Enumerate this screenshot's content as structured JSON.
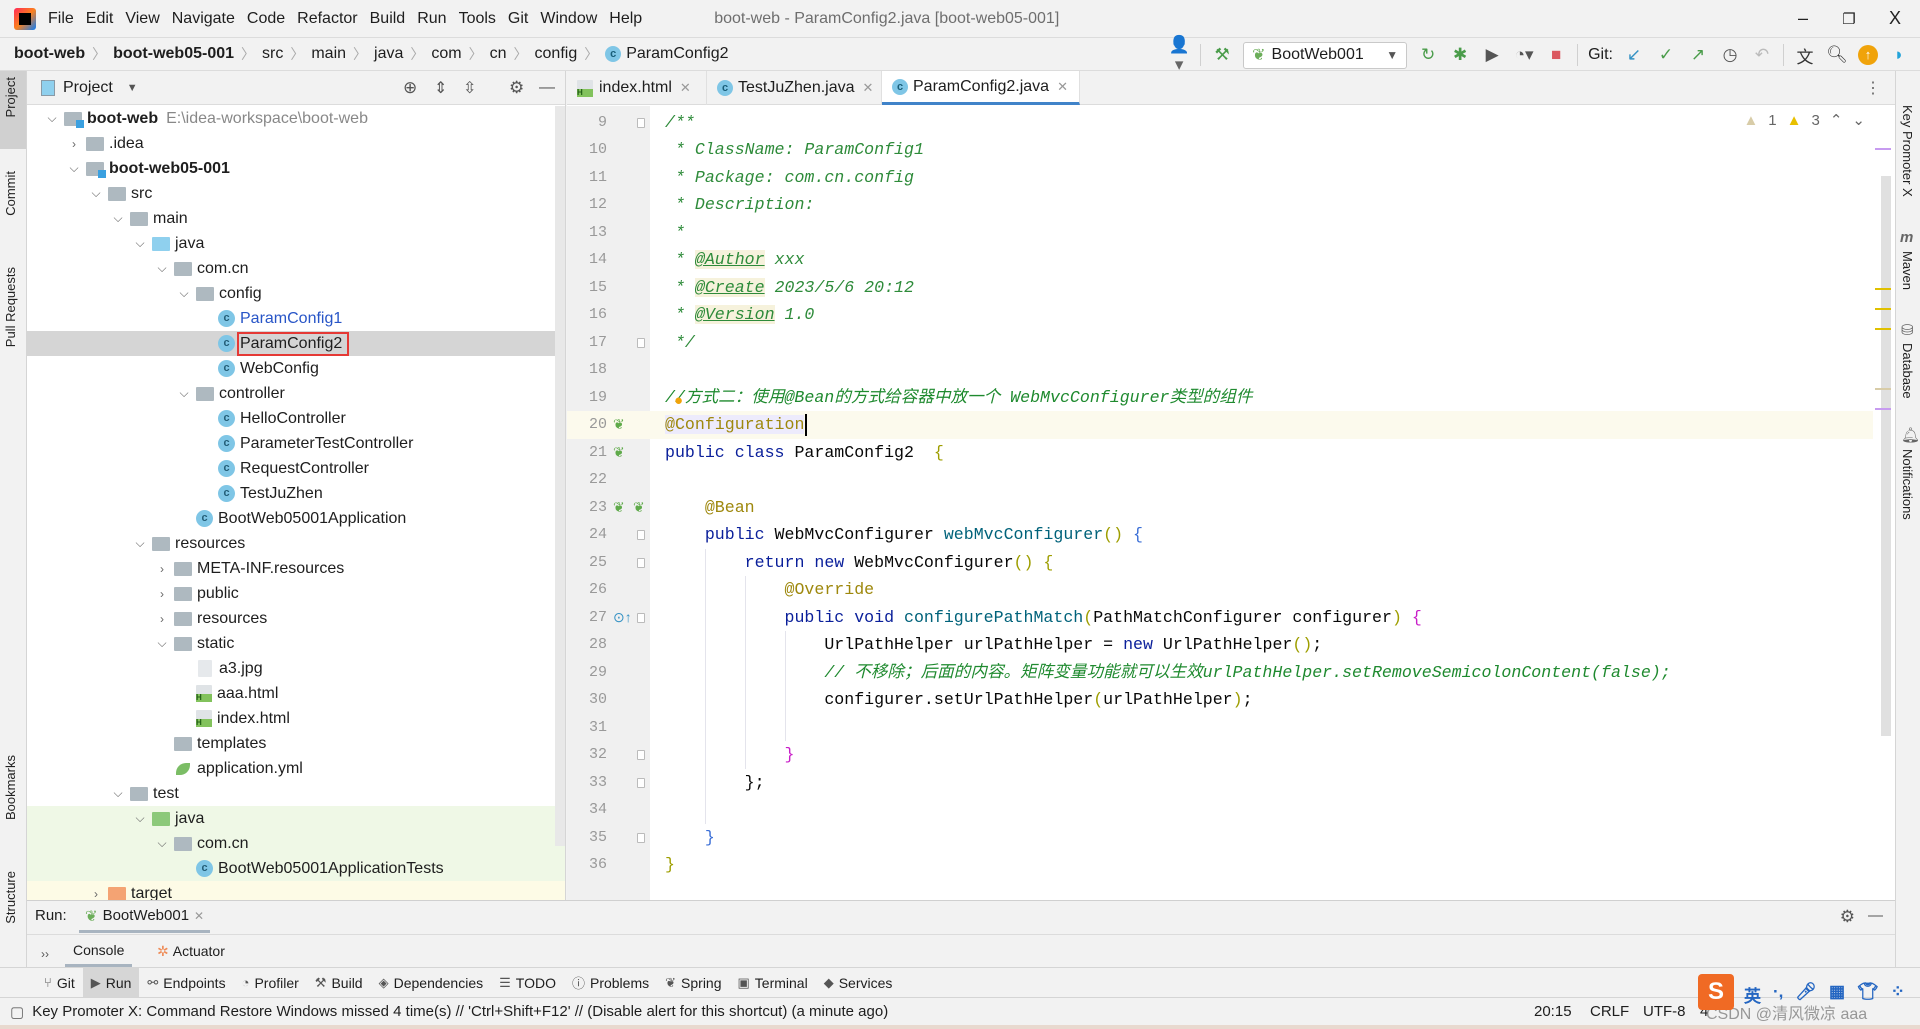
{
  "window": {
    "title": "boot-web - ParamConfig2.java [boot-web05-001]",
    "minimize": "–",
    "restore": "❐",
    "close": "X"
  },
  "menu": [
    "File",
    "Edit",
    "View",
    "Navigate",
    "Code",
    "Refactor",
    "Build",
    "Run",
    "Tools",
    "Git",
    "Window",
    "Help"
  ],
  "breadcrumb": [
    "boot-web",
    "boot-web05-001",
    "src",
    "main",
    "java",
    "com",
    "cn",
    "config",
    "ParamConfig2"
  ],
  "toolbar": {
    "run_config": "BootWeb001",
    "git_label": "Git:"
  },
  "left_stripe": [
    "Project",
    "Commit",
    "Pull Requests",
    "Bookmarks",
    "Structure"
  ],
  "right_stripe": [
    "Key Promoter X",
    "Maven",
    "Database",
    "Notifications"
  ],
  "project": {
    "title": "Project",
    "tree": [
      {
        "level": 0,
        "label": "boot-web",
        "path": "E:\\idea-workspace\\boot-web",
        "bold": true,
        "arrow": "down",
        "icon": "module"
      },
      {
        "level": 1,
        "label": ".idea",
        "arrow": "right",
        "icon": "folder"
      },
      {
        "level": 1,
        "label": "boot-web05-001",
        "bold": true,
        "arrow": "down",
        "icon": "module"
      },
      {
        "level": 2,
        "label": "src",
        "arrow": "down",
        "icon": "folder"
      },
      {
        "level": 3,
        "label": "main",
        "arrow": "down",
        "icon": "folder"
      },
      {
        "level": 4,
        "label": "java",
        "arrow": "down",
        "icon": "blue"
      },
      {
        "level": 5,
        "label": "com.cn",
        "arrow": "down",
        "icon": "folder"
      },
      {
        "level": 6,
        "label": "config",
        "arrow": "down",
        "icon": "folder"
      },
      {
        "level": 7,
        "label": "ParamConfig1",
        "icon": "cls",
        "color": "#2855c7"
      },
      {
        "level": 7,
        "label": "ParamConfig2",
        "icon": "cls",
        "selected": true
      },
      {
        "level": 7,
        "label": "WebConfig",
        "icon": "cls"
      },
      {
        "level": 6,
        "label": "controller",
        "arrow": "down",
        "icon": "folder"
      },
      {
        "level": 7,
        "label": "HelloController",
        "icon": "cls"
      },
      {
        "level": 7,
        "label": "ParameterTestController",
        "icon": "cls"
      },
      {
        "level": 7,
        "label": "RequestController",
        "icon": "cls"
      },
      {
        "level": 7,
        "label": "TestJuZhen",
        "icon": "cls"
      },
      {
        "level": 6,
        "label": "BootWeb05001Application",
        "icon": "cls"
      },
      {
        "level": 4,
        "label": "resources",
        "arrow": "down",
        "icon": "folder"
      },
      {
        "level": 5,
        "label": "META-INF.resources",
        "arrow": "right",
        "icon": "folder"
      },
      {
        "level": 5,
        "label": "public",
        "arrow": "right",
        "icon": "folder"
      },
      {
        "level": 5,
        "label": "resources",
        "arrow": "right",
        "icon": "folder"
      },
      {
        "level": 5,
        "label": "static",
        "arrow": "down",
        "icon": "folder"
      },
      {
        "level": 6,
        "label": "a3.jpg",
        "icon": "file"
      },
      {
        "level": 6,
        "label": "aaa.html",
        "icon": "html"
      },
      {
        "level": 6,
        "label": "index.html",
        "icon": "html"
      },
      {
        "level": 5,
        "label": "templates",
        "icon": "folder"
      },
      {
        "level": 5,
        "label": "application.yml",
        "icon": "yml"
      },
      {
        "level": 3,
        "label": "test",
        "arrow": "down",
        "icon": "folder"
      },
      {
        "level": 4,
        "label": "java",
        "arrow": "down",
        "icon": "green",
        "bg": "#eff8e6"
      },
      {
        "level": 5,
        "label": "com.cn",
        "arrow": "down",
        "icon": "folder",
        "bg": "#eff8e6"
      },
      {
        "level": 6,
        "label": "BootWeb05001ApplicationTests",
        "icon": "cls",
        "bg": "#eff8e6"
      },
      {
        "level": 2,
        "label": "target",
        "arrow": "right",
        "icon": "orange",
        "bg": "#fdfbe6"
      }
    ]
  },
  "tabs": [
    {
      "label": "index.html",
      "icon": "html"
    },
    {
      "label": "TestJuZhen.java",
      "icon": "cls"
    },
    {
      "label": "ParamConfig2.java",
      "icon": "cls",
      "active": true
    }
  ],
  "inspections": {
    "weak_warnings": "1",
    "warnings": "3"
  },
  "code": {
    "first_line": 8,
    "current_line": 20,
    "lines": [
      [],
      [
        [
          "/**",
          "doc"
        ]
      ],
      [
        [
          " * ClassName: ParamConfig1",
          "doc"
        ]
      ],
      [
        [
          " * Package: com.cn.config",
          "doc"
        ]
      ],
      [
        [
          " * Description:",
          "doc"
        ]
      ],
      [
        [
          " *",
          "doc"
        ]
      ],
      [
        [
          " * ",
          "doc"
        ],
        [
          "@Author",
          "doctag"
        ],
        [
          " xxx",
          "doc"
        ]
      ],
      [
        [
          " * ",
          "doc"
        ],
        [
          "@Create",
          "doctag"
        ],
        [
          " 2023/5/6 20:12",
          "doc"
        ]
      ],
      [
        [
          " * ",
          "doc"
        ],
        [
          "@Version",
          "doctag"
        ],
        [
          " 1.0",
          "doc"
        ]
      ],
      [
        [
          " */",
          "doc"
        ]
      ],
      [],
      [
        [
          "//方式二：使用@Bean的方式给容器中放一个 WebMvcConfigurer类型的组件",
          "cm"
        ]
      ],
      [
        [
          "@Configuration",
          "annhl"
        ]
      ],
      [
        [
          "public class ",
          "kw"
        ],
        [
          "ParamConfig2  ",
          "plain"
        ],
        [
          "{",
          "br1"
        ]
      ],
      [],
      [
        [
          "    @Bean",
          "ann"
        ]
      ],
      [
        [
          "    public ",
          "kw"
        ],
        [
          "WebMvcConfigurer ",
          "plain"
        ],
        [
          "webMvcConfigurer",
          "fn"
        ],
        [
          "() ",
          "br1"
        ],
        [
          "{",
          "br2"
        ]
      ],
      [
        [
          "        return new ",
          "kw"
        ],
        [
          "WebMvcConfigurer",
          "plain"
        ],
        [
          "() ",
          "br1"
        ],
        [
          "{",
          "br1"
        ]
      ],
      [
        [
          "            @Override",
          "ann"
        ]
      ],
      [
        [
          "            public void ",
          "kw"
        ],
        [
          "configurePathMatch",
          "fn"
        ],
        [
          "(",
          "br1"
        ],
        [
          "PathMatchConfigurer configurer",
          "plain"
        ],
        [
          ") ",
          "br1"
        ],
        [
          "{",
          "br3"
        ]
      ],
      [
        [
          "                UrlPathHelper urlPathHelper = ",
          "plain"
        ],
        [
          "new ",
          "kw"
        ],
        [
          "UrlPathHelper",
          "plain"
        ],
        [
          "()",
          "br1"
        ],
        [
          ";",
          "plain"
        ]
      ],
      [
        [
          "                // 不移除；后面的内容。矩阵变量功能就可以生效urlPathHelper.setRemoveSemicolonContent(false);",
          "cm"
        ]
      ],
      [
        [
          "                configurer.setUrlPathHelper",
          "plain"
        ],
        [
          "(",
          "br1"
        ],
        [
          "urlPathHelper",
          "plain"
        ],
        [
          ")",
          "br1"
        ],
        [
          ";",
          "plain"
        ]
      ],
      [],
      [
        [
          "            }",
          "br3"
        ]
      ],
      [
        [
          "        };",
          "plain"
        ]
      ],
      [],
      [
        [
          "    }",
          "br2"
        ]
      ],
      [
        [
          "}",
          "br1"
        ]
      ]
    ]
  },
  "run": {
    "label": "Run:",
    "config": "BootWeb001",
    "tabs": [
      "Console",
      "Actuator"
    ],
    "more": "››"
  },
  "bottom_tools": [
    "Git",
    "Run",
    "Endpoints",
    "Profiler",
    "Build",
    "Dependencies",
    "TODO",
    "Problems",
    "Spring",
    "Terminal",
    "Services"
  ],
  "status": {
    "message": "Key Promoter X: Command Restore Windows missed 4 time(s) // 'Ctrl+Shift+F12' // (Disable alert for this shortcut) (a minute ago)",
    "position": "20:15",
    "line_sep": "CRLF",
    "encoding": "UTF-8",
    "indent": "4",
    "watermark": "CSDN @清风微凉 aaa",
    "ime": "英"
  },
  "colors": {
    "accent": "#4083c9",
    "selection": "#d5d5d5",
    "highlight_box": "#e53935"
  }
}
